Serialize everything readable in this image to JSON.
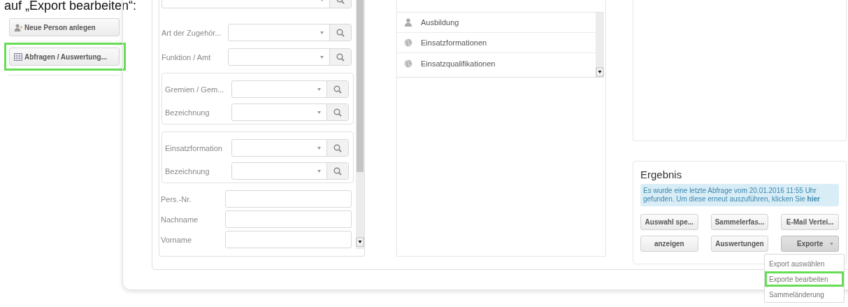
{
  "caption": "auf „Export bearbeiten“:",
  "sidebar": {
    "buttons": [
      {
        "label": "Neue Person anlegen",
        "kind": "person-add",
        "highlighted": false
      },
      {
        "label": "Abfragen / Auswertung...",
        "kind": "table",
        "highlighted": true
      }
    ]
  },
  "filter_form": {
    "rows": [
      {
        "kind": "select"
      },
      {
        "kind": "select",
        "label": "Art der Zugehör..."
      },
      {
        "kind": "select",
        "label": "Funktion / Amt"
      },
      {
        "kind": "group",
        "rows": [
          {
            "kind": "select",
            "label": "Gremien / Gem..."
          },
          {
            "kind": "select",
            "label": "Bezeichnung"
          }
        ]
      },
      {
        "kind": "group",
        "rows": [
          {
            "kind": "select",
            "label": "Einsatzformation"
          },
          {
            "kind": "select",
            "label": "Bezeichnung"
          }
        ]
      },
      {
        "kind": "text",
        "label": "Pers.-Nr."
      },
      {
        "kind": "text",
        "label": "Nachname"
      },
      {
        "kind": "text",
        "label": "Vorname"
      }
    ]
  },
  "category_list": {
    "items": [
      {
        "label": "Ausbildung",
        "kind": "person"
      },
      {
        "label": "Einsatzformationen",
        "kind": "globe"
      },
      {
        "label": "Einsatzqualifikationen",
        "kind": "globe"
      }
    ]
  },
  "result": {
    "title": "Ergebnis",
    "notice": "Es wurde eine letzte Abfrage vom 20.01.2016 11:55 Uhr gefunden. Um diese erneut auszuführen, klicken Sie **hier**",
    "buttons": [
      {
        "label": "Auswahl spe...",
        "kind": "plain",
        "active": false
      },
      {
        "label": "Sammelerfas...",
        "kind": "plain",
        "active": false
      },
      {
        "label": "E-Mail Vertei...",
        "kind": "plain",
        "active": false
      },
      {
        "label": "anzeigen",
        "kind": "plain",
        "active": false
      },
      {
        "label": "Auswertungen",
        "kind": "plain",
        "active": false
      },
      {
        "label": "Exporte",
        "kind": "dropdown",
        "active": true
      }
    ],
    "menu": [
      {
        "label": "Export auswählen",
        "highlighted": false
      },
      {
        "label": "Exporte bearbeiten",
        "highlighted": true
      },
      {
        "label": "Sammeländerung",
        "highlighted": false
      }
    ]
  }
}
